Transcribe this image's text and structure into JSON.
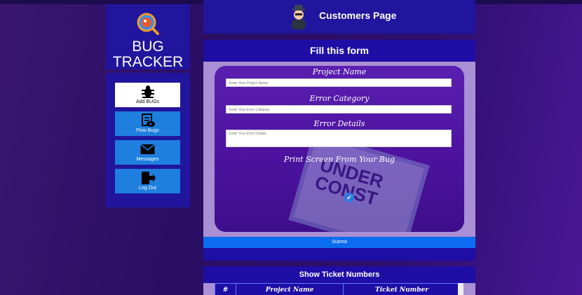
{
  "brand": {
    "line1": "BUG",
    "line2": "TRACKER",
    "logo_icon": "bug-magnifier-logo-icon"
  },
  "sidebar": {
    "items": [
      {
        "label": "Add BUGs",
        "icon": "bug-icon",
        "active": true
      },
      {
        "label": "Flow Bugs",
        "icon": "document-eye-icon",
        "active": false
      },
      {
        "label": "Messages",
        "icon": "envelope-icon",
        "active": false
      },
      {
        "label": "Log Out",
        "icon": "logout-door-icon",
        "active": false
      }
    ]
  },
  "header": {
    "title": "Customers Page",
    "avatar_icon": "spy-avatar-icon"
  },
  "form": {
    "title": "Fill this form",
    "project_name_label": "Project Name",
    "project_name_placeholder": "Enter Your Project Name",
    "error_category_label": "Error Category",
    "error_category_placeholder": "Enter Your Error Category",
    "error_details_label": "Error Details",
    "error_details_placeholder": "Enter Your Error Details",
    "print_screen_label": "Print Screen From Your Bug",
    "submit_label": "Submit"
  },
  "tickets": {
    "title": "Show Ticket Numbers",
    "columns": [
      "#",
      "Project Name",
      "Ticket Number"
    ]
  },
  "colors": {
    "accent": "#20159c",
    "button": "#1e7fde",
    "submit": "#0a6cf0"
  }
}
